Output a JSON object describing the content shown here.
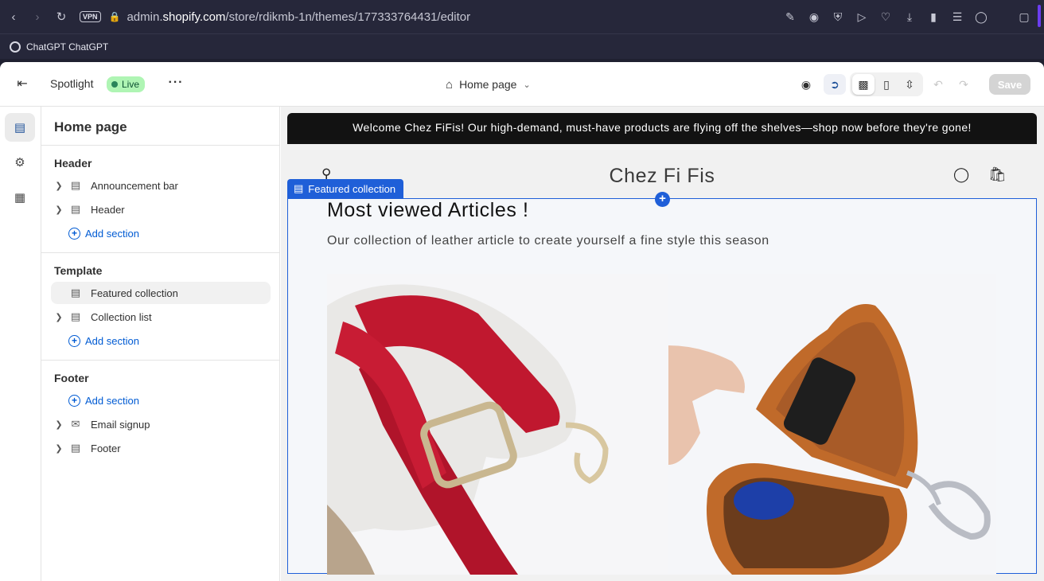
{
  "browser": {
    "url_prefix": "admin.",
    "url_host": "shopify.com",
    "url_path": "/store/rdikmb-1n/themes/177333764431/editor",
    "vpn_label": "VPN",
    "bookmark_label": "ChatGPT ChatGPT",
    "nav_icons": [
      "back-icon",
      "forward-icon",
      "reload-icon"
    ],
    "toolbar_icons": [
      "edit-icon",
      "camera-icon",
      "shield-icon",
      "play-icon",
      "heart-icon",
      "download-icon",
      "battery-icon",
      "menu-icon",
      "profile-icon"
    ]
  },
  "topbar": {
    "theme_name": "Spotlight",
    "status": "Live",
    "page": "Home page",
    "save_label": "Save"
  },
  "sidebar": {
    "title": "Home page",
    "groups": {
      "header": {
        "title": "Header",
        "items": [
          "Announcement bar",
          "Header"
        ],
        "add_label": "Add section"
      },
      "template": {
        "title": "Template",
        "items": [
          "Featured collection",
          "Collection list"
        ],
        "add_label": "Add section"
      },
      "footer": {
        "title": "Footer",
        "add_label": "Add section",
        "items": [
          "Email signup",
          "Footer"
        ]
      }
    }
  },
  "preview": {
    "announcement": "Welcome Chez FiFis! Our high-demand, must-have products are flying off the shelves—shop now before they're gone!",
    "store_name": "Chez Fi Fis",
    "section_tag": "Featured collection",
    "heading": "Most viewed Articles !",
    "description": "Our collection of leather article to create yourself a fine style this season"
  },
  "colors": {
    "accent_blue": "#1f5fd8",
    "live_green": "#aff5b4",
    "link_blue": "#005bd3"
  }
}
